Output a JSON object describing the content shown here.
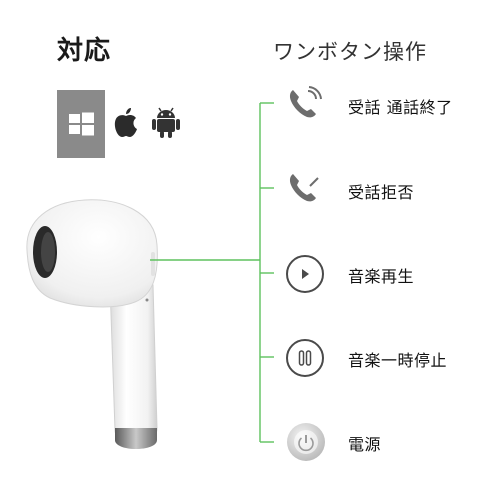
{
  "header": {
    "compatibility": "対応",
    "one_button": "ワンボタン操作"
  },
  "platforms": [
    "windows-icon",
    "apple-icon",
    "android-icon"
  ],
  "functions": [
    {
      "icon": "phone-ringing-icon",
      "label": "受話 通話終了"
    },
    {
      "icon": "phone-reject-icon",
      "label": "受話拒否"
    },
    {
      "icon": "play-icon",
      "label": "音楽再生"
    },
    {
      "icon": "pause-icon",
      "label": "音楽一時停止"
    },
    {
      "icon": "power-icon",
      "label": "電源"
    }
  ],
  "colors": {
    "connector_line": "#5ec25e",
    "windows_tile": "#8a8a8a",
    "icon_gray": "#6d6d6d"
  }
}
